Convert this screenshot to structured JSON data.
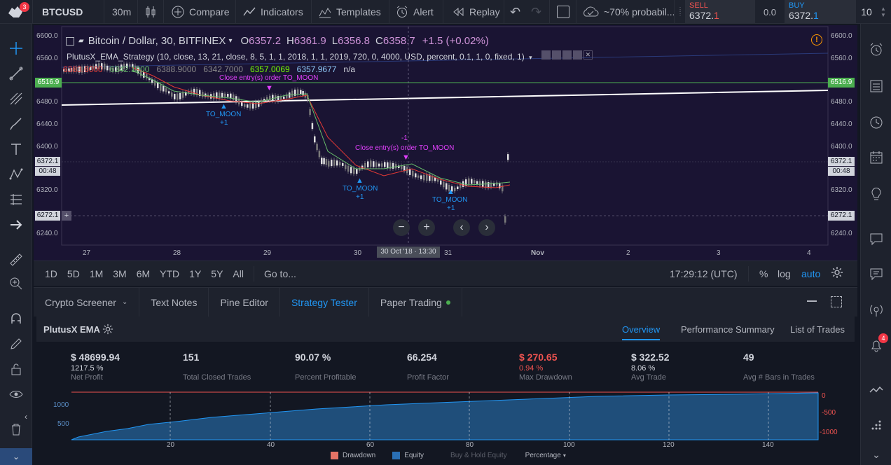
{
  "toolbar": {
    "symbol": "BTCUSD",
    "interval": "30m",
    "compare": "Compare",
    "indicators": "Indicators",
    "templates": "Templates",
    "alert": "Alert",
    "replay": "Replay",
    "probability": "~70% probabil...",
    "sell_label": "SELL",
    "sell_price_main": "6372.",
    "sell_price_tail": "1",
    "spread": "0.0",
    "buy_label": "BUY",
    "buy_price_main": "6372.",
    "buy_price_tail": "1",
    "quantity": "10",
    "logo_badge": "3"
  },
  "chart": {
    "title": "Bitcoin / Dollar, 30, BITFINEX",
    "ohlc": {
      "o_label": "O",
      "o": "6357.2",
      "h_label": "H",
      "h": "6361.9",
      "l_label": "L",
      "l": "6356.8",
      "c_label": "C",
      "c": "6358.7",
      "change": "+1.5 (+0.02%)"
    },
    "strategy_line": "PlutusX_EMA_Strategy (10, close, 13, 21, close, 8, 5, 1, 1, 2018, 1, 1, 2019, 720, 0, 4000, USD, percent, 0.1, 1, 0, fixed, 1)",
    "indicator_values": [
      "6383.6000",
      "6342.1000",
      "6388.9000",
      "6342.7000",
      "6357.0069",
      "6357.9677",
      "n/a"
    ],
    "annotations": {
      "close1": "Close entry(s) order TO_MOON",
      "close2": "Close entry(s) order TO_MOON",
      "close2_qty": "-1",
      "moon1": "TO_MOON",
      "moon1_qty": "+1",
      "moon2": "TO_MOON",
      "moon2_qty": "+1",
      "moon3": "TO_MOON",
      "moon3_qty": "+1"
    },
    "y_ticks": [
      "6600.0",
      "6560.0",
      "6520.0",
      "6480.0",
      "6440.0",
      "6400.0",
      "6360.0",
      "6320.0",
      "6280.0",
      "6240.0"
    ],
    "left_labels": {
      "green": "6516.9",
      "price": "6372.1",
      "time": "00:48",
      "cross": "6272.1"
    },
    "right_labels": {
      "green": "6516.9",
      "price": "6372.1",
      "time": "00:48",
      "cross": "6272.1"
    },
    "x_ticks": [
      "27",
      "28",
      "29",
      "30",
      "31",
      "Nov",
      "2",
      "3",
      "4"
    ],
    "crosshair_time": "30 Oct '18 · 13:30"
  },
  "bottom": {
    "ranges": [
      "1D",
      "5D",
      "1M",
      "3M",
      "6M",
      "YTD",
      "1Y",
      "5Y",
      "All"
    ],
    "goto": "Go to...",
    "clock": "17:29:12 (UTC)",
    "percent": "%",
    "log": "log",
    "auto": "auto"
  },
  "tabs": [
    "Crypto Screener",
    "Text Notes",
    "Pine Editor",
    "Strategy Tester",
    "Paper Trading"
  ],
  "strategy": {
    "name": "PlutusX EMA",
    "views": [
      "Overview",
      "Performance Summary",
      "List of Trades"
    ],
    "stats": [
      {
        "value": "$ 48699.94",
        "pct": "1217.5 %",
        "label": "Net Profit"
      },
      {
        "value": "151",
        "pct": "",
        "label": "Total Closed Trades"
      },
      {
        "value": "90.07 %",
        "pct": "",
        "label": "Percent Profitable"
      },
      {
        "value": "66.254",
        "pct": "",
        "label": "Profit Factor"
      },
      {
        "value": "$ 270.65",
        "pct": "0.94 %",
        "label": "Max Drawdown"
      },
      {
        "value": "$ 322.52",
        "pct": "8.06 %",
        "label": "Avg Trade"
      },
      {
        "value": "49",
        "pct": "",
        "label": "Avg # Bars in Trades"
      }
    ],
    "equity_y": [
      "1000",
      "500"
    ],
    "drawdown_y": [
      "0",
      "-500",
      "-1000"
    ],
    "x_ticks": [
      "20",
      "40",
      "60",
      "80",
      "100",
      "120",
      "140"
    ],
    "legend": {
      "drawdown": "Drawdown",
      "equity": "Equity",
      "buyhold": "Buy & Hold Equity",
      "mode": "Percentage"
    }
  },
  "right_sidebar": {
    "alert_badge": "4"
  },
  "colors": {
    "accent": "#2196f3",
    "sell": "#ef5350",
    "green_line": "#4caf50",
    "strategy_purple": "#e040fb",
    "equity_fill": "#1f4e7a"
  }
}
